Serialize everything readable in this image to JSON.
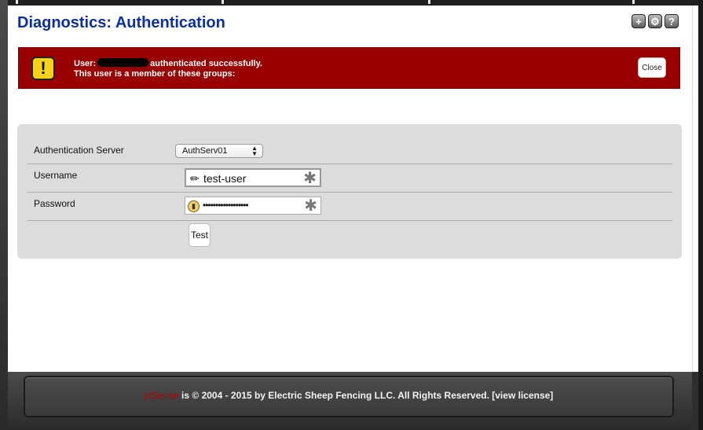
{
  "page": {
    "title": "Diagnostics: Authentication"
  },
  "header_icons": [
    {
      "name": "add-icon",
      "glyph": "+"
    },
    {
      "name": "settings-icon",
      "glyph": "⚙"
    },
    {
      "name": "help-icon",
      "glyph": "?"
    }
  ],
  "alert": {
    "icon_glyph": "!",
    "user_prefix": "User:",
    "user_suffix": "authenticated successfully.",
    "line2": "This user is a member of these groups:",
    "close_label": "Close",
    "background": "#990000"
  },
  "form": {
    "server": {
      "label": "Authentication Server",
      "value": "AuthServ01"
    },
    "username": {
      "label": "Username",
      "value": "test-user",
      "icon": "pencil-icon"
    },
    "password": {
      "label": "Password",
      "value": "••••••••••••••••••",
      "icon": "lock-icon"
    },
    "test_label": "Test"
  },
  "footer": {
    "brand": "pfSense",
    "text": " is © 2004 - 2015 by Electric Sheep Fencing LLC. All Rights Reserved. ",
    "license_link": "[view license]",
    "brand_color": "#b30000"
  }
}
